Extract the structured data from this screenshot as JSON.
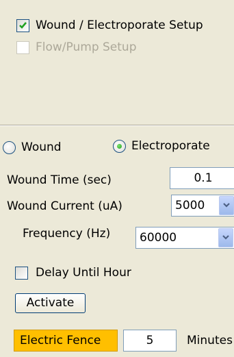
{
  "setup": {
    "wound_electroporate": {
      "label": "Wound / Electroporate Setup",
      "checked": true
    },
    "flow_pump": {
      "label": "Flow/Pump Setup",
      "checked": false,
      "enabled": false
    }
  },
  "mode": {
    "wound_label": "Wound",
    "electroporate_label": "Electroporate",
    "selected": "Electroporate"
  },
  "fields": {
    "wound_time_label": "Wound Time (sec)",
    "wound_time_value": "0.1",
    "wound_current_label": "Wound Current (uA)",
    "wound_current_value": "5000",
    "frequency_label": "Frequency (Hz)",
    "frequency_value": "60000"
  },
  "delay": {
    "label": "Delay Until Hour",
    "checked": false
  },
  "activate_label": "Activate",
  "status": {
    "badge": "Electric Fence",
    "badge_color": "#ffbf00",
    "duration_value": "5",
    "duration_unit": "Minutes"
  }
}
